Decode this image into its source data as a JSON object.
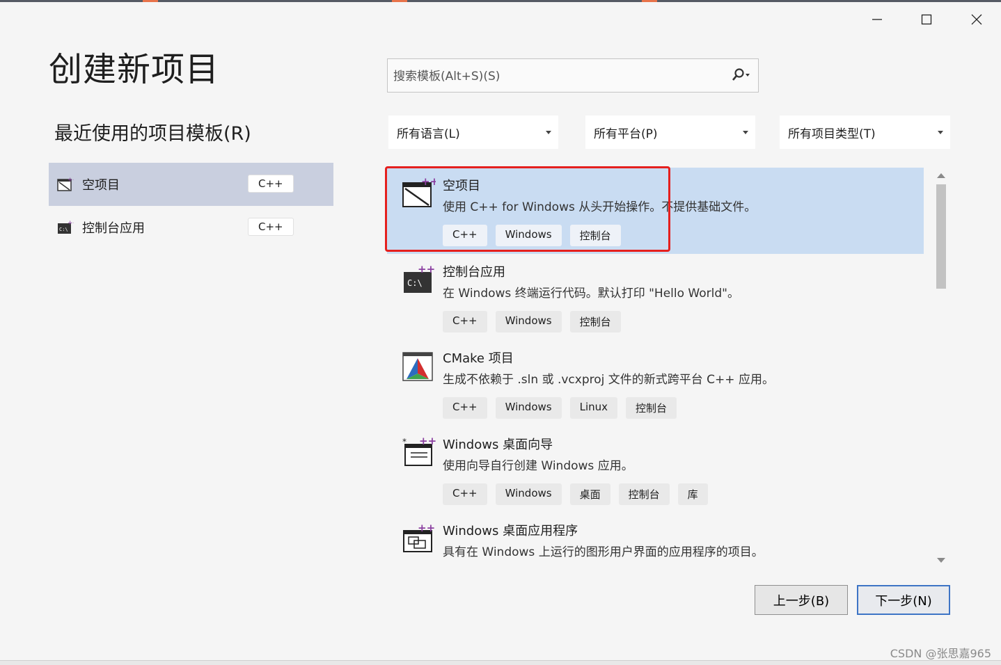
{
  "window": {
    "title": "创建新项目",
    "minimize_icon": "minimize-icon",
    "maximize_icon": "maximize-icon",
    "close_icon": "close-icon"
  },
  "recent": {
    "heading": "最近使用的项目模板(R)",
    "items": [
      {
        "label": "空项目",
        "tag": "C++",
        "icon": "empty-project-icon",
        "selected": true
      },
      {
        "label": "控制台应用",
        "tag": "C++",
        "icon": "console-app-icon",
        "selected": false
      }
    ]
  },
  "search": {
    "placeholder": "搜索模板(Alt+S)(S)",
    "value": "",
    "icon": "search-icon"
  },
  "filters": {
    "language": "所有语言(L)",
    "platform": "所有平台(P)",
    "project_type": "所有项目类型(T)"
  },
  "templates": [
    {
      "title": "空项目",
      "description": "使用 C++ for Windows 从头开始操作。不提供基础文件。",
      "tags": [
        "C++",
        "Windows",
        "控制台"
      ],
      "icon": "empty-project-icon",
      "selected": true
    },
    {
      "title": "控制台应用",
      "description": "在 Windows 终端运行代码。默认打印 \"Hello World\"。",
      "tags": [
        "C++",
        "Windows",
        "控制台"
      ],
      "icon": "console-app-icon",
      "selected": false
    },
    {
      "title": "CMake 项目",
      "description": "生成不依赖于 .sln 或 .vcxproj 文件的新式跨平台 C++ 应用。",
      "tags": [
        "C++",
        "Windows",
        "Linux",
        "控制台"
      ],
      "icon": "cmake-icon",
      "selected": false
    },
    {
      "title": "Windows 桌面向导",
      "description": "使用向导自行创建 Windows 应用。",
      "tags": [
        "C++",
        "Windows",
        "桌面",
        "控制台",
        "库"
      ],
      "icon": "wizard-icon",
      "selected": false
    },
    {
      "title": "Windows 桌面应用程序",
      "description": "具有在 Windows 上运行的图形用户界面的应用程序的项目。",
      "tags": [],
      "icon": "desktop-app-icon",
      "selected": false
    }
  ],
  "buttons": {
    "back": "上一步(B)",
    "next": "下一步(N)"
  },
  "watermark": "CSDN @张思嘉965",
  "colors": {
    "selection_recent": "#c9cfdf",
    "selection_template": "#c9dcf2",
    "highlight_border": "#e5201e",
    "primary_button_border": "#3d74c5"
  }
}
